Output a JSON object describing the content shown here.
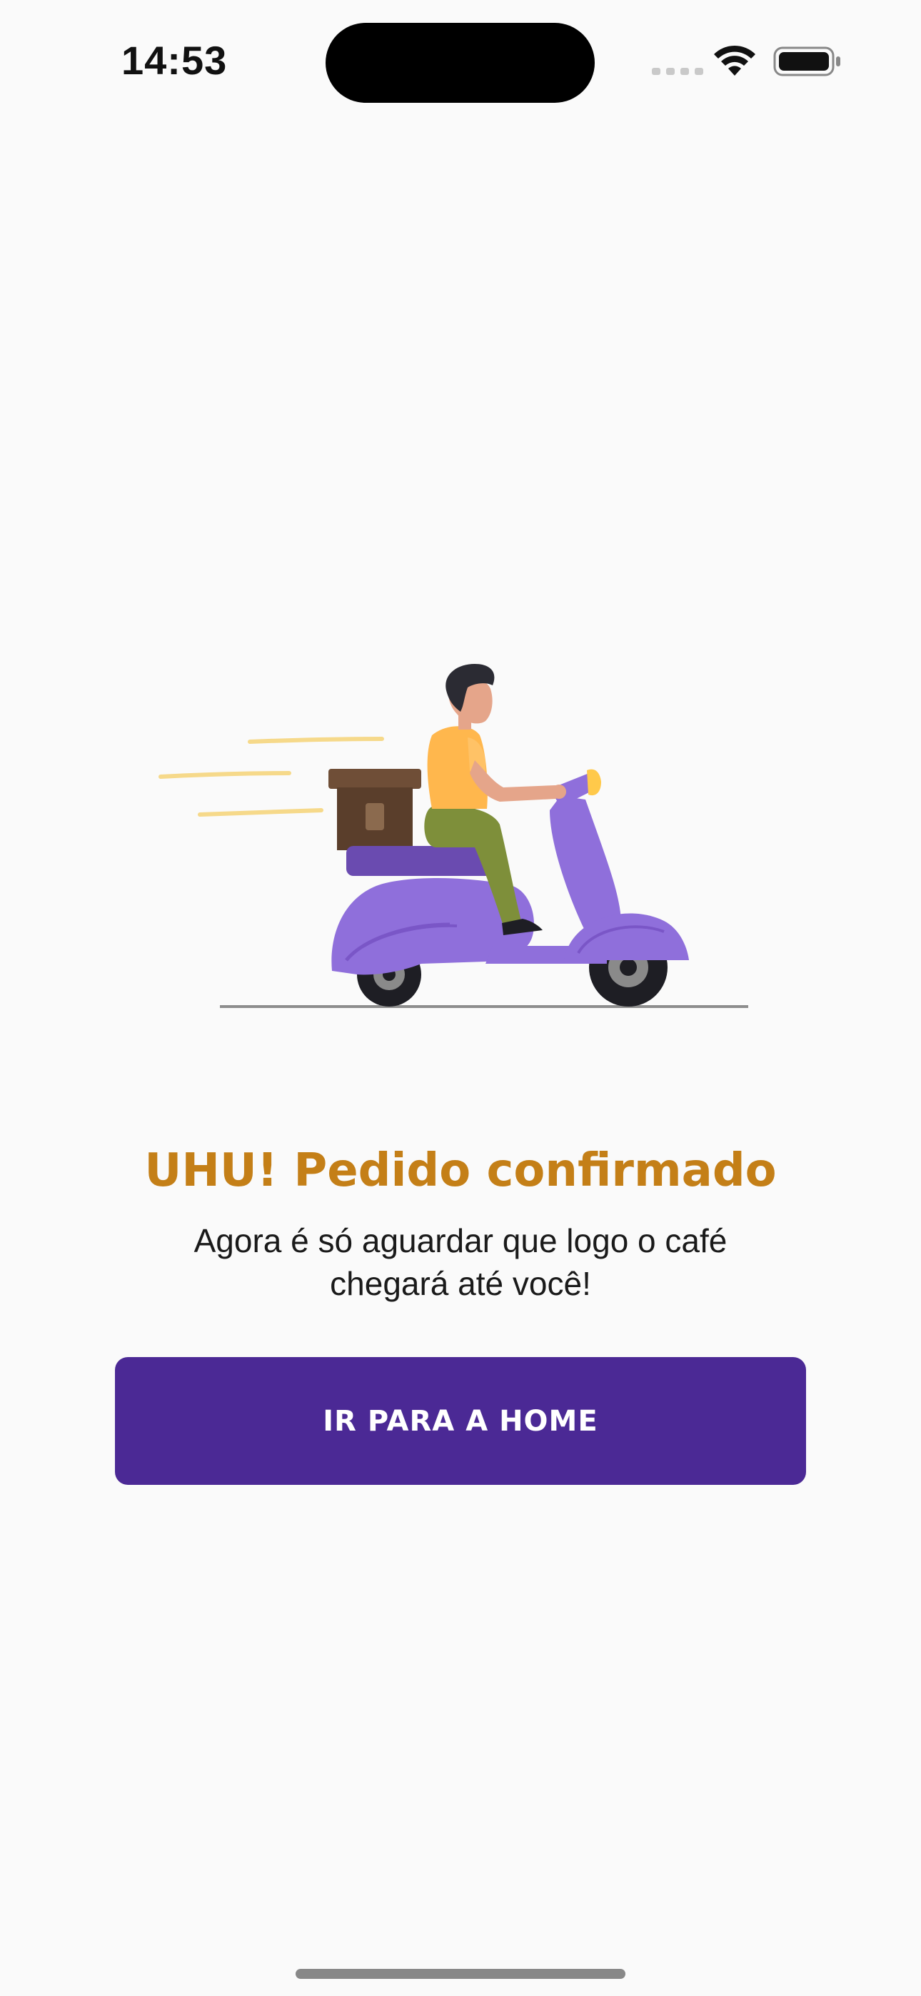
{
  "status_bar": {
    "time": "14:53",
    "icons": [
      "cellular-signal-icon",
      "wifi-icon",
      "battery-icon"
    ]
  },
  "illustration": {
    "name": "delivery-scooter-illustration"
  },
  "confirmation": {
    "title": "UHU! Pedido confirmado",
    "subtitle": "Agora é só aguardar que logo o café chegará até você!"
  },
  "actions": {
    "home_button_label": "IR PARA A HOME"
  },
  "colors": {
    "title": "#C47F17",
    "button": "#4B2995",
    "background": "#FAFAFA",
    "scooter": "#8F6FDB"
  }
}
